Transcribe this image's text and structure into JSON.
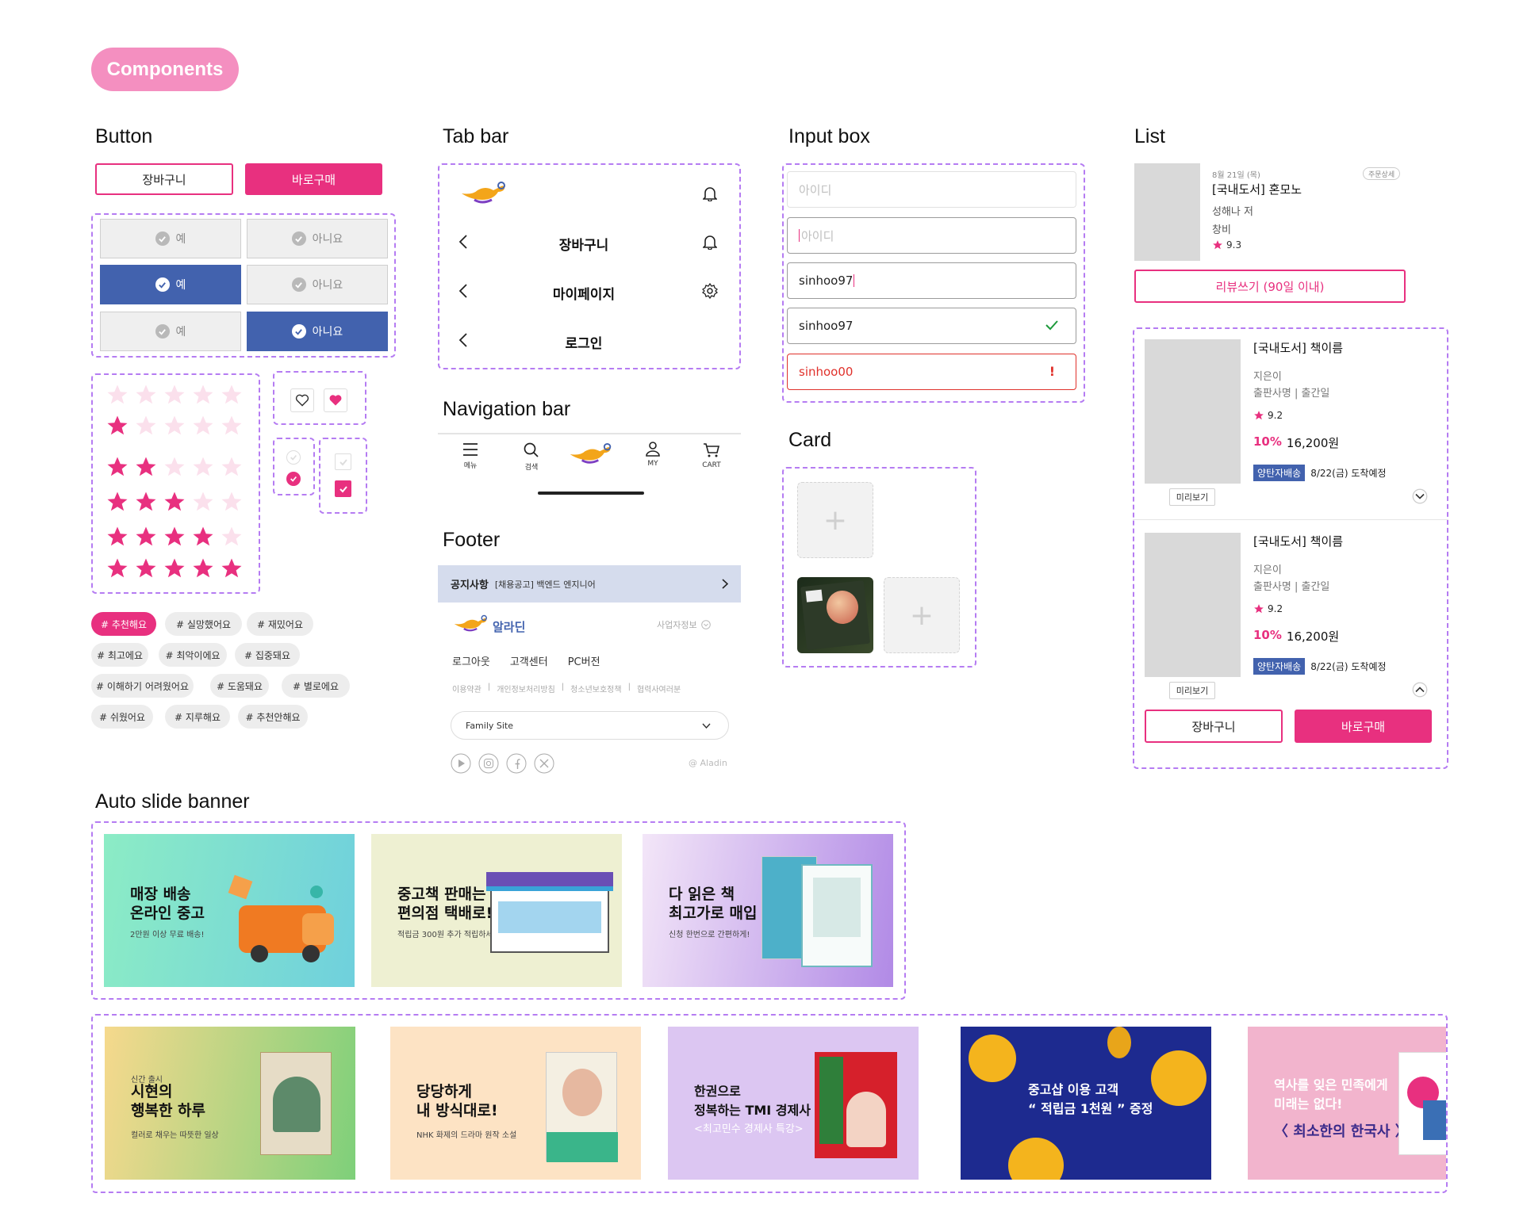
{
  "header": {
    "label": "Components"
  },
  "sections": {
    "button": "Button",
    "tab_bar": "Tab bar",
    "input_box": "Input box",
    "list": "List",
    "navigation_bar": "Navigation bar",
    "card": "Card",
    "footer": "Footer",
    "auto_slide_banner": "Auto slide banner"
  },
  "buttons": {
    "cart": "장바구니",
    "buy_now": "바로구매",
    "yes": "예",
    "no": "아니요",
    "option_rows": [
      {
        "yes_selected": false,
        "no_selected": false
      },
      {
        "yes_selected": true,
        "no_selected": false
      },
      {
        "yes_selected": false,
        "no_selected": true
      }
    ],
    "star_rows_filled": [
      0,
      1,
      2,
      3,
      4,
      5
    ],
    "tags": [
      "# 추천해요",
      "# 실망했어요",
      "# 재밌어요",
      "# 최고에요",
      "# 최악이에요",
      "# 집중돼요",
      "# 이해하기 어려웠어요",
      "# 도움돼요",
      "# 별로에요",
      "# 쉬웠어요",
      "# 지루해요",
      "# 추천안해요"
    ],
    "selected_tag": "# 추천해요",
    "colors": {
      "accent": "#e8307f",
      "blue": "#4262ae",
      "star_empty": "#fbe0ec"
    }
  },
  "tab_bar": {
    "rows": [
      {
        "title": "",
        "left_icon": "genie-lamp-logo",
        "right_icon": "bell-icon"
      },
      {
        "title": "장바구니",
        "left_icon": "back-icon",
        "right_icon": "bell-icon"
      },
      {
        "title": "마이페이지",
        "left_icon": "back-icon",
        "right_icon": "gear-icon"
      },
      {
        "title": "로그인",
        "left_icon": "back-icon",
        "right_icon": ""
      }
    ]
  },
  "nav_bar": {
    "items": [
      {
        "label": "메뉴",
        "icon": "menu-icon"
      },
      {
        "label": "검색",
        "icon": "search-icon"
      },
      {
        "label": "",
        "icon": "genie-lamp-logo"
      },
      {
        "label": "MY",
        "icon": "user-icon"
      },
      {
        "label": "CART",
        "icon": "cart-icon"
      }
    ]
  },
  "footer": {
    "notice_label": "공지사항",
    "notice_text": "[채용공고] 백엔드 엔지니어",
    "brand": "알라딘",
    "business_info": "사업자정보",
    "links": [
      "로그아웃",
      "고객센터",
      "PC버전"
    ],
    "policies": [
      "이용약관",
      "개인정보처리방침",
      "청소년보호정책",
      "협력사여러분"
    ],
    "family_site": "Family Site",
    "social_icons": [
      "youtube-icon",
      "instagram-icon",
      "facebook-icon",
      "x-icon"
    ],
    "copyright": "@ Aladin"
  },
  "input_box": {
    "fields": [
      {
        "placeholder": "아이디",
        "value": "",
        "state": "default"
      },
      {
        "placeholder": "아이디",
        "value": "",
        "state": "focused"
      },
      {
        "placeholder": "",
        "value": "sinhoo97",
        "state": "typing"
      },
      {
        "placeholder": "",
        "value": "sinhoo97",
        "state": "valid"
      },
      {
        "placeholder": "",
        "value": "sinhoo00",
        "state": "error"
      }
    ]
  },
  "card": {
    "add_symbol": "+"
  },
  "list": {
    "order": {
      "date": "8월 21일 (목)",
      "detail_button": "주문상세",
      "title": "[국내도서] 혼모노",
      "author": "성해나 저",
      "publisher": "창비",
      "rating": "9.3",
      "review_button": "리뷰쓰기 (90일 이내)"
    },
    "products": [
      {
        "title": "[국내도서] 책이름",
        "author": "지은이",
        "publisher": "출판사명 | 출간일",
        "rating": "9.2",
        "discount": "10%",
        "price": "16,200원",
        "shipping": "양탄자배송",
        "arrival": "8/22(금) 도착예정",
        "preview": "미리보기",
        "chevron": "down"
      },
      {
        "title": "[국내도서] 책이름",
        "author": "지은이",
        "publisher": "출판사명 | 출간일",
        "rating": "9.2",
        "discount": "10%",
        "price": "16,200원",
        "shipping": "양탄자배송",
        "arrival": "8/22(금) 도착예정",
        "preview": "미리보기",
        "chevron": "up"
      }
    ],
    "cart_button": "장바구니",
    "buy_button": "바로구매"
  },
  "banners_row1": [
    {
      "title": "매장 배송\n온라인 중고",
      "sub": "2만원 이상 무료 배송!",
      "bg": "linear-gradient(100deg,#8cecc5,#6fd0dd)"
    },
    {
      "title": "중고책 판매는\n편의점 택배로!",
      "sub": "적립금 300원 추가 적립하세요",
      "bg": "#eef0d2"
    },
    {
      "title": "다 읽은 책\n최고가로 매입",
      "sub": "신청 한번으로 간편하게!",
      "bg": "linear-gradient(100deg,#f3e6f8,#b18ae6)"
    }
  ],
  "banners_row2": [
    {
      "pre": "신간 출시",
      "title": "시현의\n행복한 하루",
      "sub": "컬러로 채우는 따뜻한 일상",
      "bg": "linear-gradient(100deg,#f6d98d,#7ed07a)"
    },
    {
      "pre": "",
      "title": "당당하게\n내 방식대로!",
      "sub": "NHK 화제의 드라마 원작 소설",
      "bg": "#fde3c4"
    },
    {
      "pre": "",
      "title": "한권으로\n정복하는 TMI 경제사",
      "sub": "<최고민수 경제사 특강>",
      "bg": "#dcc6f2"
    },
    {
      "pre": "",
      "title": "중고샵 이용 고객\n“ 적립금 1천원 ” 증정",
      "sub": "",
      "bg": "#1d2a8f"
    },
    {
      "pre": "",
      "title": "역사를 잊은 민족에게\n미래는 없다!",
      "sub": "〈 최소한의 한국사 〉",
      "bg": "#f2b4cd"
    }
  ]
}
